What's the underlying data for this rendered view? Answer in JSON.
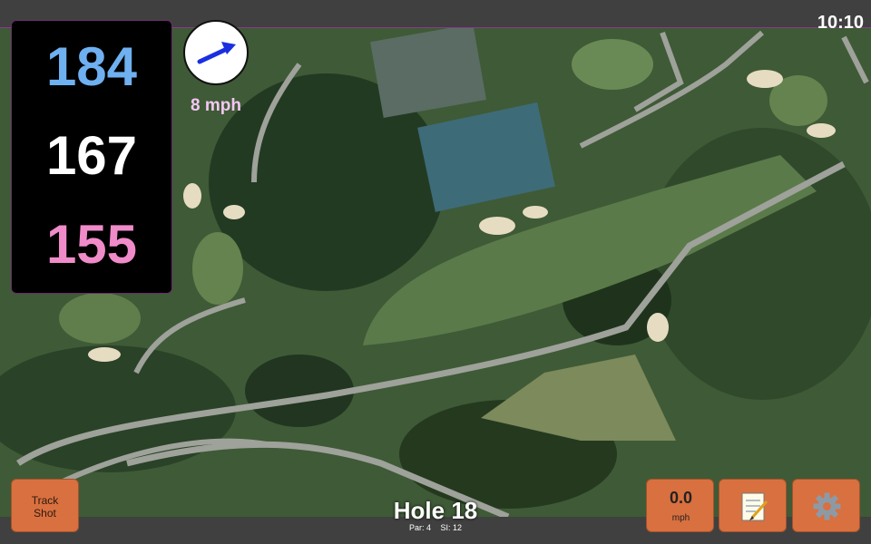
{
  "status": {
    "time": "10:10"
  },
  "distances": {
    "back": "184",
    "middle": "167",
    "front": "155",
    "back_color": "#6fb0f0",
    "middle_color": "#ffffff",
    "front_color": "#f08bc9"
  },
  "wind": {
    "speed_label": "8 mph",
    "arrow_icon": "wind-arrow-icon"
  },
  "hole": {
    "title": "Hole 18",
    "par": "Par: 4",
    "stroke_index": "SI: 12"
  },
  "buttons": {
    "track_shot_line1": "Track",
    "track_shot_line2": "Shot",
    "speed_value": "0.0",
    "speed_unit": "mph",
    "notes_icon": "notepad-icon",
    "settings_icon": "gear-icon"
  },
  "colors": {
    "button": "#d9703f",
    "bar": "#404040",
    "accent": "#8a3a8a"
  }
}
